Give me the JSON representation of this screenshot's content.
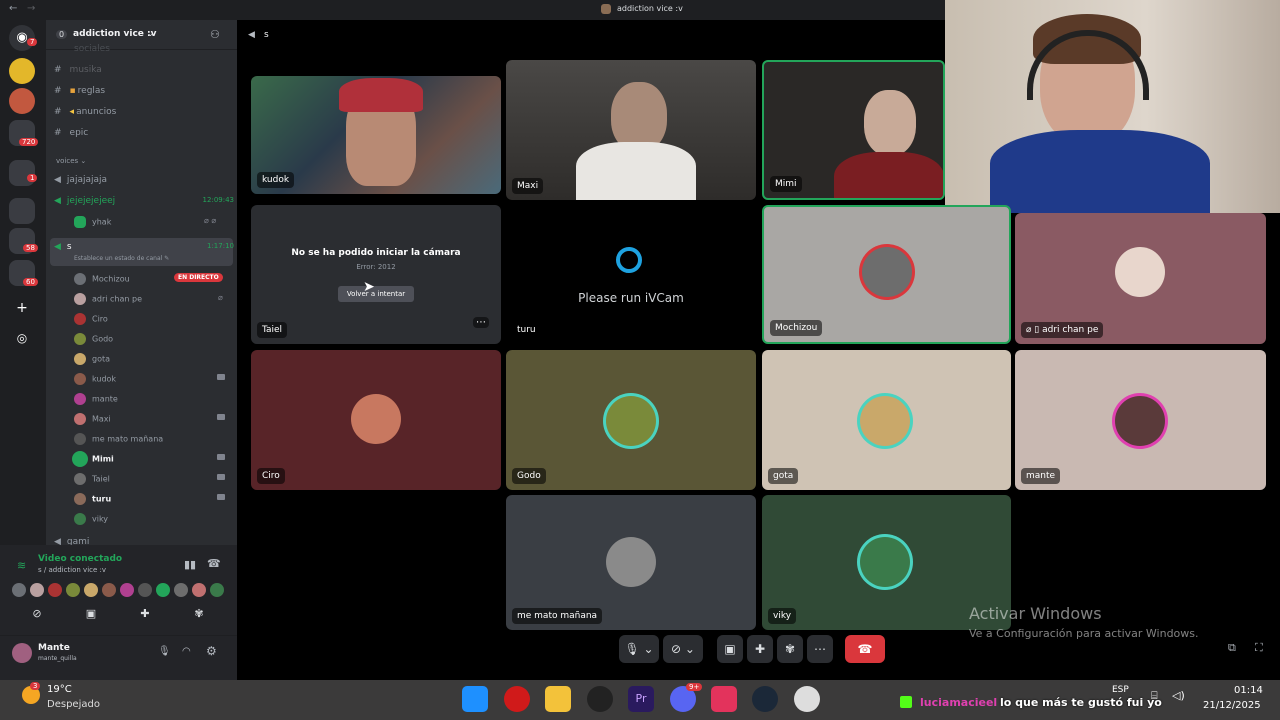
{
  "titlebar": {
    "title": "addiction vice :v"
  },
  "server": {
    "name": "addiction vice :v",
    "badge": "0"
  },
  "channels": {
    "partial_top": "sociales",
    "text": [
      "musika",
      "reglas",
      "anuncios",
      "epic"
    ],
    "category_voices": "voices",
    "voice": [
      {
        "name": "jajajajaja"
      },
      {
        "name": "jejejejejeej",
        "time": "12:09:43",
        "users": [
          "yhak"
        ]
      },
      {
        "name": "s",
        "time": "1:17:10",
        "status": "Establece un estado de canal"
      }
    ],
    "partial_bottom": "gami"
  },
  "channel_users": [
    "Mochizou",
    "adri chan pe",
    "Ciro",
    "Godo",
    "gota",
    "kudok",
    "mante",
    "Maxi",
    "me mato mañana",
    "Mimi",
    "Taiel",
    "turu",
    "viky"
  ],
  "live_badge": "EN DIRECTO",
  "voice_connected": {
    "status": "Video conectado",
    "location": "s / addiction vice :v"
  },
  "user": {
    "name": "Mante",
    "handle": "mante_quilla"
  },
  "call": {
    "channel": "s"
  },
  "tiles": {
    "kudok": "kudok",
    "maxi": "Maxi",
    "mimi": "Mimi",
    "taiel": "Taiel",
    "turu": "turu",
    "mochizou": "Mochizou",
    "adri": "adri chan pe",
    "ciro": "Ciro",
    "godo": "Godo",
    "gota": "gota",
    "mante": "mante",
    "memato": "me mato mañana",
    "viky": "viky"
  },
  "camera_error": {
    "title": "No se ha podido iniciar la cámara",
    "code": "Error: 2012",
    "retry": "Volver a intentar"
  },
  "ivcam": "Please run iVCam",
  "watermark": {
    "line1": "Activar Windows",
    "line2": "Ve a Configuración para activar Windows."
  },
  "taskbar": {
    "weather": "19°C",
    "condition": "Despejado",
    "weather_badge": "3",
    "chat_user": "luciamacieel",
    "chat_text": "lo que más te gustó fui yo",
    "lang": "ESP",
    "time": "01:14",
    "date": "21/12/2025",
    "discord_badge": "9+"
  },
  "guild_badges": [
    "7",
    "720",
    "1",
    "58",
    "60"
  ],
  "colors": {
    "accent": "#23a55a",
    "danger": "#da373c",
    "blurple": "#5865f2"
  }
}
